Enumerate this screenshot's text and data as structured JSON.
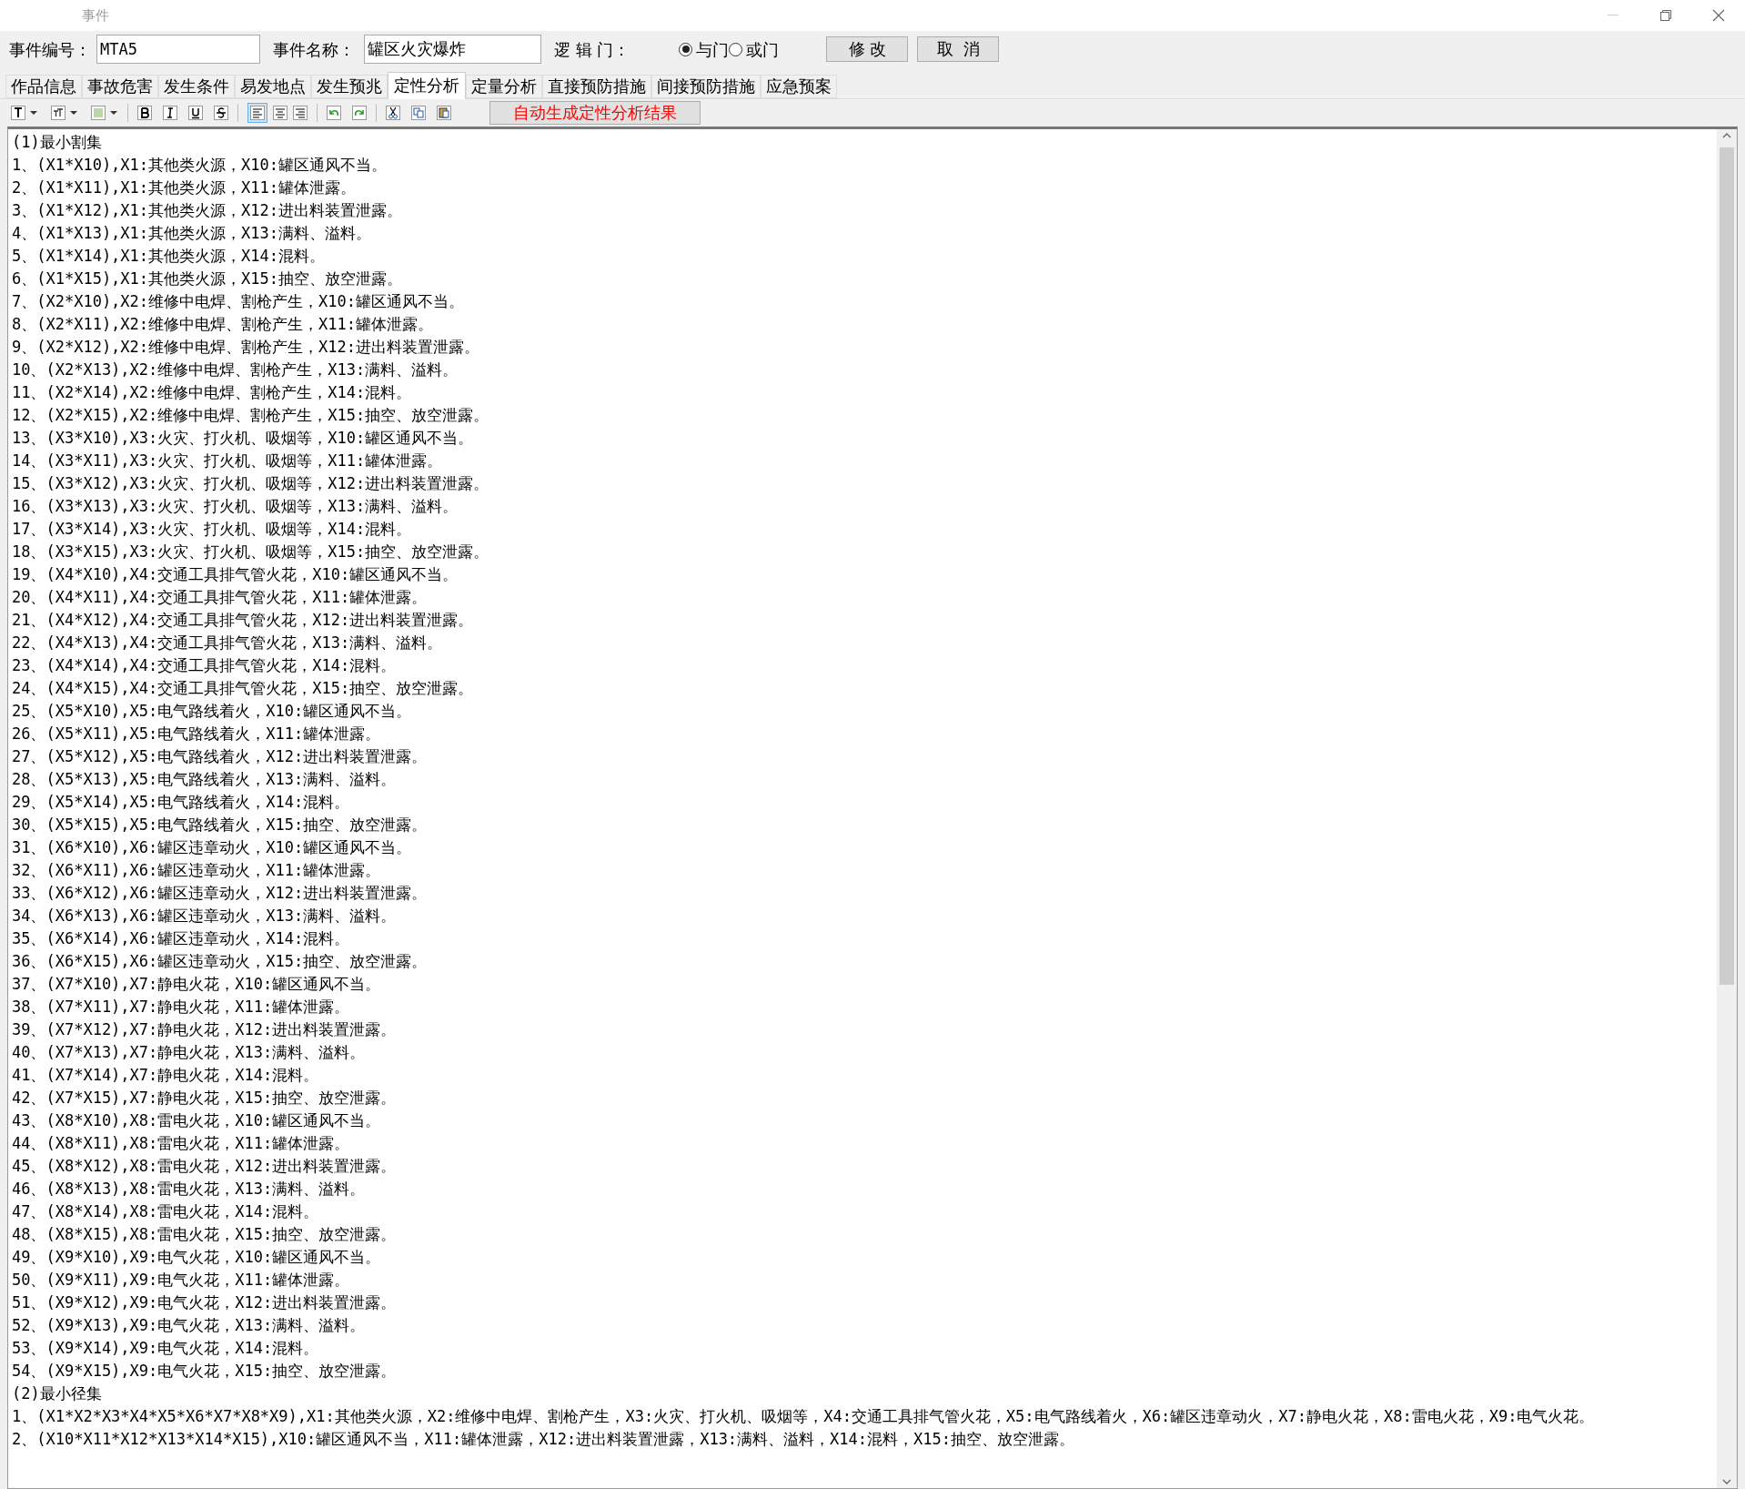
{
  "window": {
    "title": "事件"
  },
  "form": {
    "id_label": "事件编号：",
    "id_value": "MTA5",
    "name_label": "事件名称：",
    "name_value": "罐区火灾爆炸",
    "gate_label": "逻 辑 门：",
    "gates": [
      {
        "label": "与门",
        "selected": true
      },
      {
        "label": "或门",
        "selected": false
      }
    ],
    "buttons": [
      "修 改",
      "取  消"
    ]
  },
  "tabs": [
    {
      "label": "作品信息",
      "selected": false
    },
    {
      "label": "事故危害",
      "selected": false
    },
    {
      "label": "发生条件",
      "selected": false
    },
    {
      "label": "易发地点",
      "selected": false
    },
    {
      "label": "发生预兆",
      "selected": false
    },
    {
      "label": "定性分析",
      "selected": true
    },
    {
      "label": "定量分析",
      "selected": false
    },
    {
      "label": "直接预防措施",
      "selected": false
    },
    {
      "label": "间接预防措施",
      "selected": false
    },
    {
      "label": "应急预案",
      "selected": false
    }
  ],
  "toolbar": {
    "align_buttons": [
      {
        "selected": true
      },
      {
        "selected": false
      },
      {
        "selected": false
      }
    ],
    "generate_button": "自动生成定性分析结果"
  },
  "editor": {
    "lines": [
      "(1)最小割集",
      "1、(X1*X10),X1:其他类火源，X10:罐区通风不当。",
      "2、(X1*X11),X1:其他类火源，X11:罐体泄露。",
      "3、(X1*X12),X1:其他类火源，X12:进出料装置泄露。",
      "4、(X1*X13),X1:其他类火源，X13:满料、溢料。",
      "5、(X1*X14),X1:其他类火源，X14:混料。",
      "6、(X1*X15),X1:其他类火源，X15:抽空、放空泄露。",
      "7、(X2*X10),X2:维修中电焊、割枪产生，X10:罐区通风不当。",
      "8、(X2*X11),X2:维修中电焊、割枪产生，X11:罐体泄露。",
      "9、(X2*X12),X2:维修中电焊、割枪产生，X12:进出料装置泄露。",
      "10、(X2*X13),X2:维修中电焊、割枪产生，X13:满料、溢料。",
      "11、(X2*X14),X2:维修中电焊、割枪产生，X14:混料。",
      "12、(X2*X15),X2:维修中电焊、割枪产生，X15:抽空、放空泄露。",
      "13、(X3*X10),X3:火灾、打火机、吸烟等，X10:罐区通风不当。",
      "14、(X3*X11),X3:火灾、打火机、吸烟等，X11:罐体泄露。",
      "15、(X3*X12),X3:火灾、打火机、吸烟等，X12:进出料装置泄露。",
      "16、(X3*X13),X3:火灾、打火机、吸烟等，X13:满料、溢料。",
      "17、(X3*X14),X3:火灾、打火机、吸烟等，X14:混料。",
      "18、(X3*X15),X3:火灾、打火机、吸烟等，X15:抽空、放空泄露。",
      "19、(X4*X10),X4:交通工具排气管火花，X10:罐区通风不当。",
      "20、(X4*X11),X4:交通工具排气管火花，X11:罐体泄露。",
      "21、(X4*X12),X4:交通工具排气管火花，X12:进出料装置泄露。",
      "22、(X4*X13),X4:交通工具排气管火花，X13:满料、溢料。",
      "23、(X4*X14),X4:交通工具排气管火花，X14:混料。",
      "24、(X4*X15),X4:交通工具排气管火花，X15:抽空、放空泄露。",
      "25、(X5*X10),X5:电气路线着火，X10:罐区通风不当。",
      "26、(X5*X11),X5:电气路线着火，X11:罐体泄露。",
      "27、(X5*X12),X5:电气路线着火，X12:进出料装置泄露。",
      "28、(X5*X13),X5:电气路线着火，X13:满料、溢料。",
      "29、(X5*X14),X5:电气路线着火，X14:混料。",
      "30、(X5*X15),X5:电气路线着火，X15:抽空、放空泄露。",
      "31、(X6*X10),X6:罐区违章动火，X10:罐区通风不当。",
      "32、(X6*X11),X6:罐区违章动火，X11:罐体泄露。",
      "33、(X6*X12),X6:罐区违章动火，X12:进出料装置泄露。",
      "34、(X6*X13),X6:罐区违章动火，X13:满料、溢料。",
      "35、(X6*X14),X6:罐区违章动火，X14:混料。",
      "36、(X6*X15),X6:罐区违章动火，X15:抽空、放空泄露。",
      "37、(X7*X10),X7:静电火花，X10:罐区通风不当。",
      "38、(X7*X11),X7:静电火花，X11:罐体泄露。",
      "39、(X7*X12),X7:静电火花，X12:进出料装置泄露。",
      "40、(X7*X13),X7:静电火花，X13:满料、溢料。",
      "41、(X7*X14),X7:静电火花，X14:混料。",
      "42、(X7*X15),X7:静电火花，X15:抽空、放空泄露。",
      "43、(X8*X10),X8:雷电火花，X10:罐区通风不当。",
      "44、(X8*X11),X8:雷电火花，X11:罐体泄露。",
      "45、(X8*X12),X8:雷电火花，X12:进出料装置泄露。",
      "46、(X8*X13),X8:雷电火花，X13:满料、溢料。",
      "47、(X8*X14),X8:雷电火花，X14:混料。",
      "48、(X8*X15),X8:雷电火花，X15:抽空、放空泄露。",
      "49、(X9*X10),X9:电气火花，X10:罐区通风不当。",
      "50、(X9*X11),X9:电气火花，X11:罐体泄露。",
      "51、(X9*X12),X9:电气火花，X12:进出料装置泄露。",
      "52、(X9*X13),X9:电气火花，X13:满料、溢料。",
      "53、(X9*X14),X9:电气火花，X14:混料。",
      "54、(X9*X15),X9:电气火花，X15:抽空、放空泄露。",
      "(2)最小径集",
      "1、(X1*X2*X3*X4*X5*X6*X7*X8*X9),X1:其他类火源，X2:维修中电焊、割枪产生，X3:火灾、打火机、吸烟等，X4:交通工具排气管火花，X5:电气路线着火，X6:罐区违章动火，X7:静电火花，X8:雷电火花，X9:电气火花。",
      "2、(X10*X11*X12*X13*X14*X15),X10:罐区通风不当，X11:罐体泄露，X12:进出料装置泄露，X13:满料、溢料，X14:混料，X15:抽空、放空泄露。"
    ]
  }
}
